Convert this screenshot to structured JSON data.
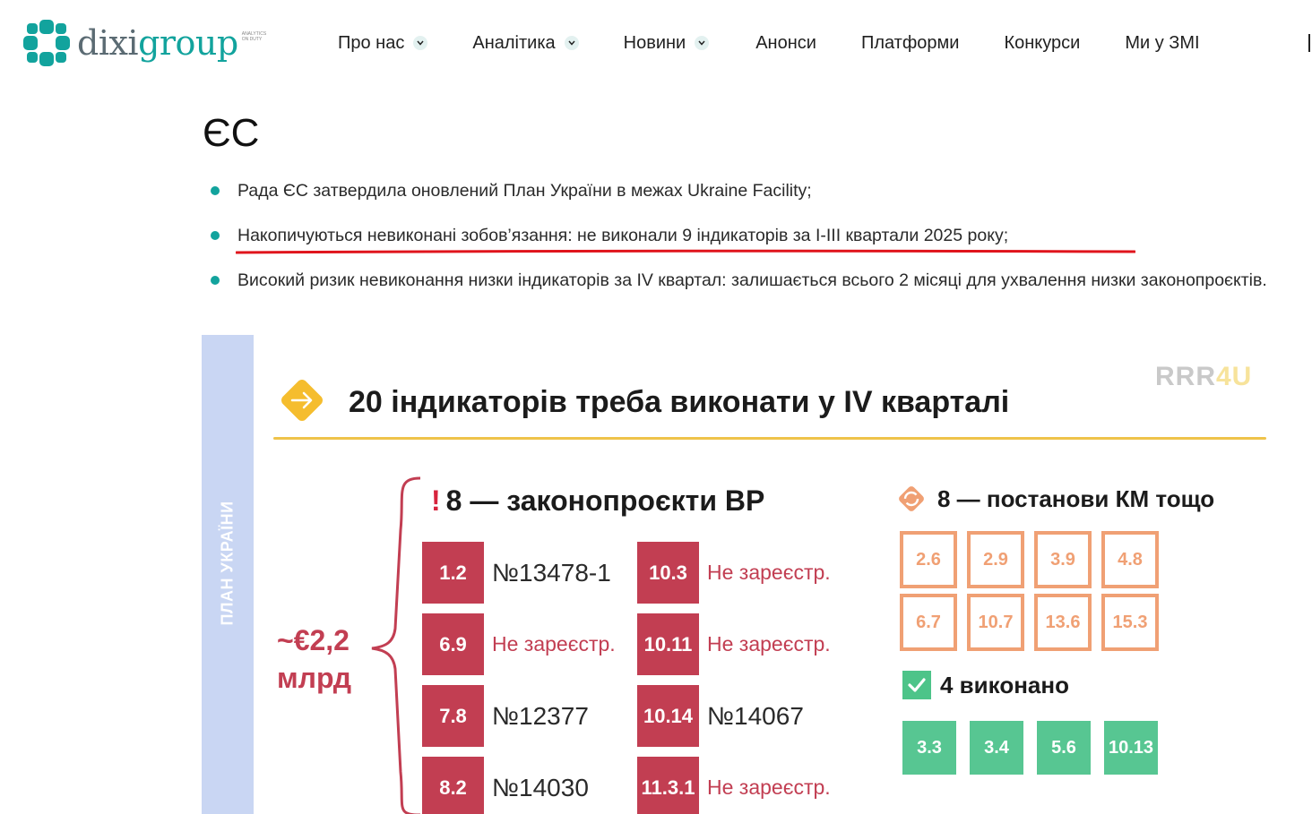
{
  "header": {
    "logo_prefix": "dixi",
    "logo_suffix": "group",
    "logo_tagline": "analytics on duty",
    "nav": [
      {
        "label": "Про нас",
        "has_dropdown": true
      },
      {
        "label": "Аналітика",
        "has_dropdown": true
      },
      {
        "label": "Новини",
        "has_dropdown": true
      },
      {
        "label": "Анонси",
        "has_dropdown": false
      },
      {
        "label": "Платформи",
        "has_dropdown": false
      },
      {
        "label": "Конкурси",
        "has_dropdown": false
      },
      {
        "label": "Ми у ЗМІ",
        "has_dropdown": false
      }
    ]
  },
  "article": {
    "title": "ЄС",
    "bullets": [
      "Рада ЄС затвердила оновлений План України в межах Ukraine Facility;",
      "Накопичуються невиконані зобов’язання: не виконали 9 індикаторів за I-III квартали 2025 року;",
      "Високий ризик невиконання низки індикаторів за IV квартал: залишається всього 2 місяці для ухвалення низки законопроєктів."
    ]
  },
  "infographic": {
    "side_label": "ПЛАН УКРАЇНИ",
    "title": "20 індикаторів треба виконати у IV кварталі",
    "brand_a": "RRR",
    "brand_b": "4U",
    "amount_line1": "~€2,2",
    "amount_line2": "млрд",
    "laws_excl": "!",
    "laws_title": "8 — законопроєкти ВР",
    "laws": [
      {
        "code": "1.2",
        "status": "№13478-1"
      },
      {
        "code": "6.9",
        "status": "Не зареєстр."
      },
      {
        "code": "7.8",
        "status": "№12377"
      },
      {
        "code": "8.2",
        "status": "№14030"
      },
      {
        "code": "10.3",
        "status": "Не зареєстр."
      },
      {
        "code": "10.11",
        "status": "Не зареєстр."
      },
      {
        "code": "10.14",
        "status": "№14067"
      },
      {
        "code": "11.3.1",
        "status": "Не зареєстр."
      }
    ],
    "km_title": "8 — постанови КМ тощо",
    "km": [
      "2.6",
      "2.9",
      "3.9",
      "4.8",
      "6.7",
      "10.7",
      "13.6",
      "15.3"
    ],
    "done_title": "4 виконано",
    "done": [
      "3.3",
      "3.4",
      "5.6",
      "10.13"
    ],
    "colors": {
      "teal": "#12a39d",
      "law_red": "#c23e52",
      "km_orange": "#f0a074",
      "done_green": "#57c692",
      "accent_yellow": "#efc34a"
    }
  }
}
